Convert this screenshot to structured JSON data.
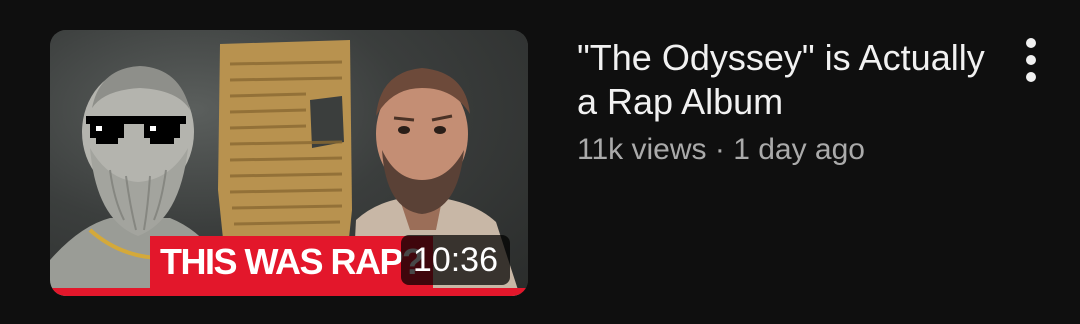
{
  "video": {
    "title": "\"The Odyssey\" is Actually a Rap Album",
    "views": "11k views",
    "separator": "·",
    "age": "1 day ago",
    "duration": "10:36",
    "thumbnail_caption": "THIS WAS RAP?",
    "accent_color": "#e3172b",
    "watch_progress": 1.0
  },
  "icons": {
    "menu": "more-vert-icon"
  }
}
